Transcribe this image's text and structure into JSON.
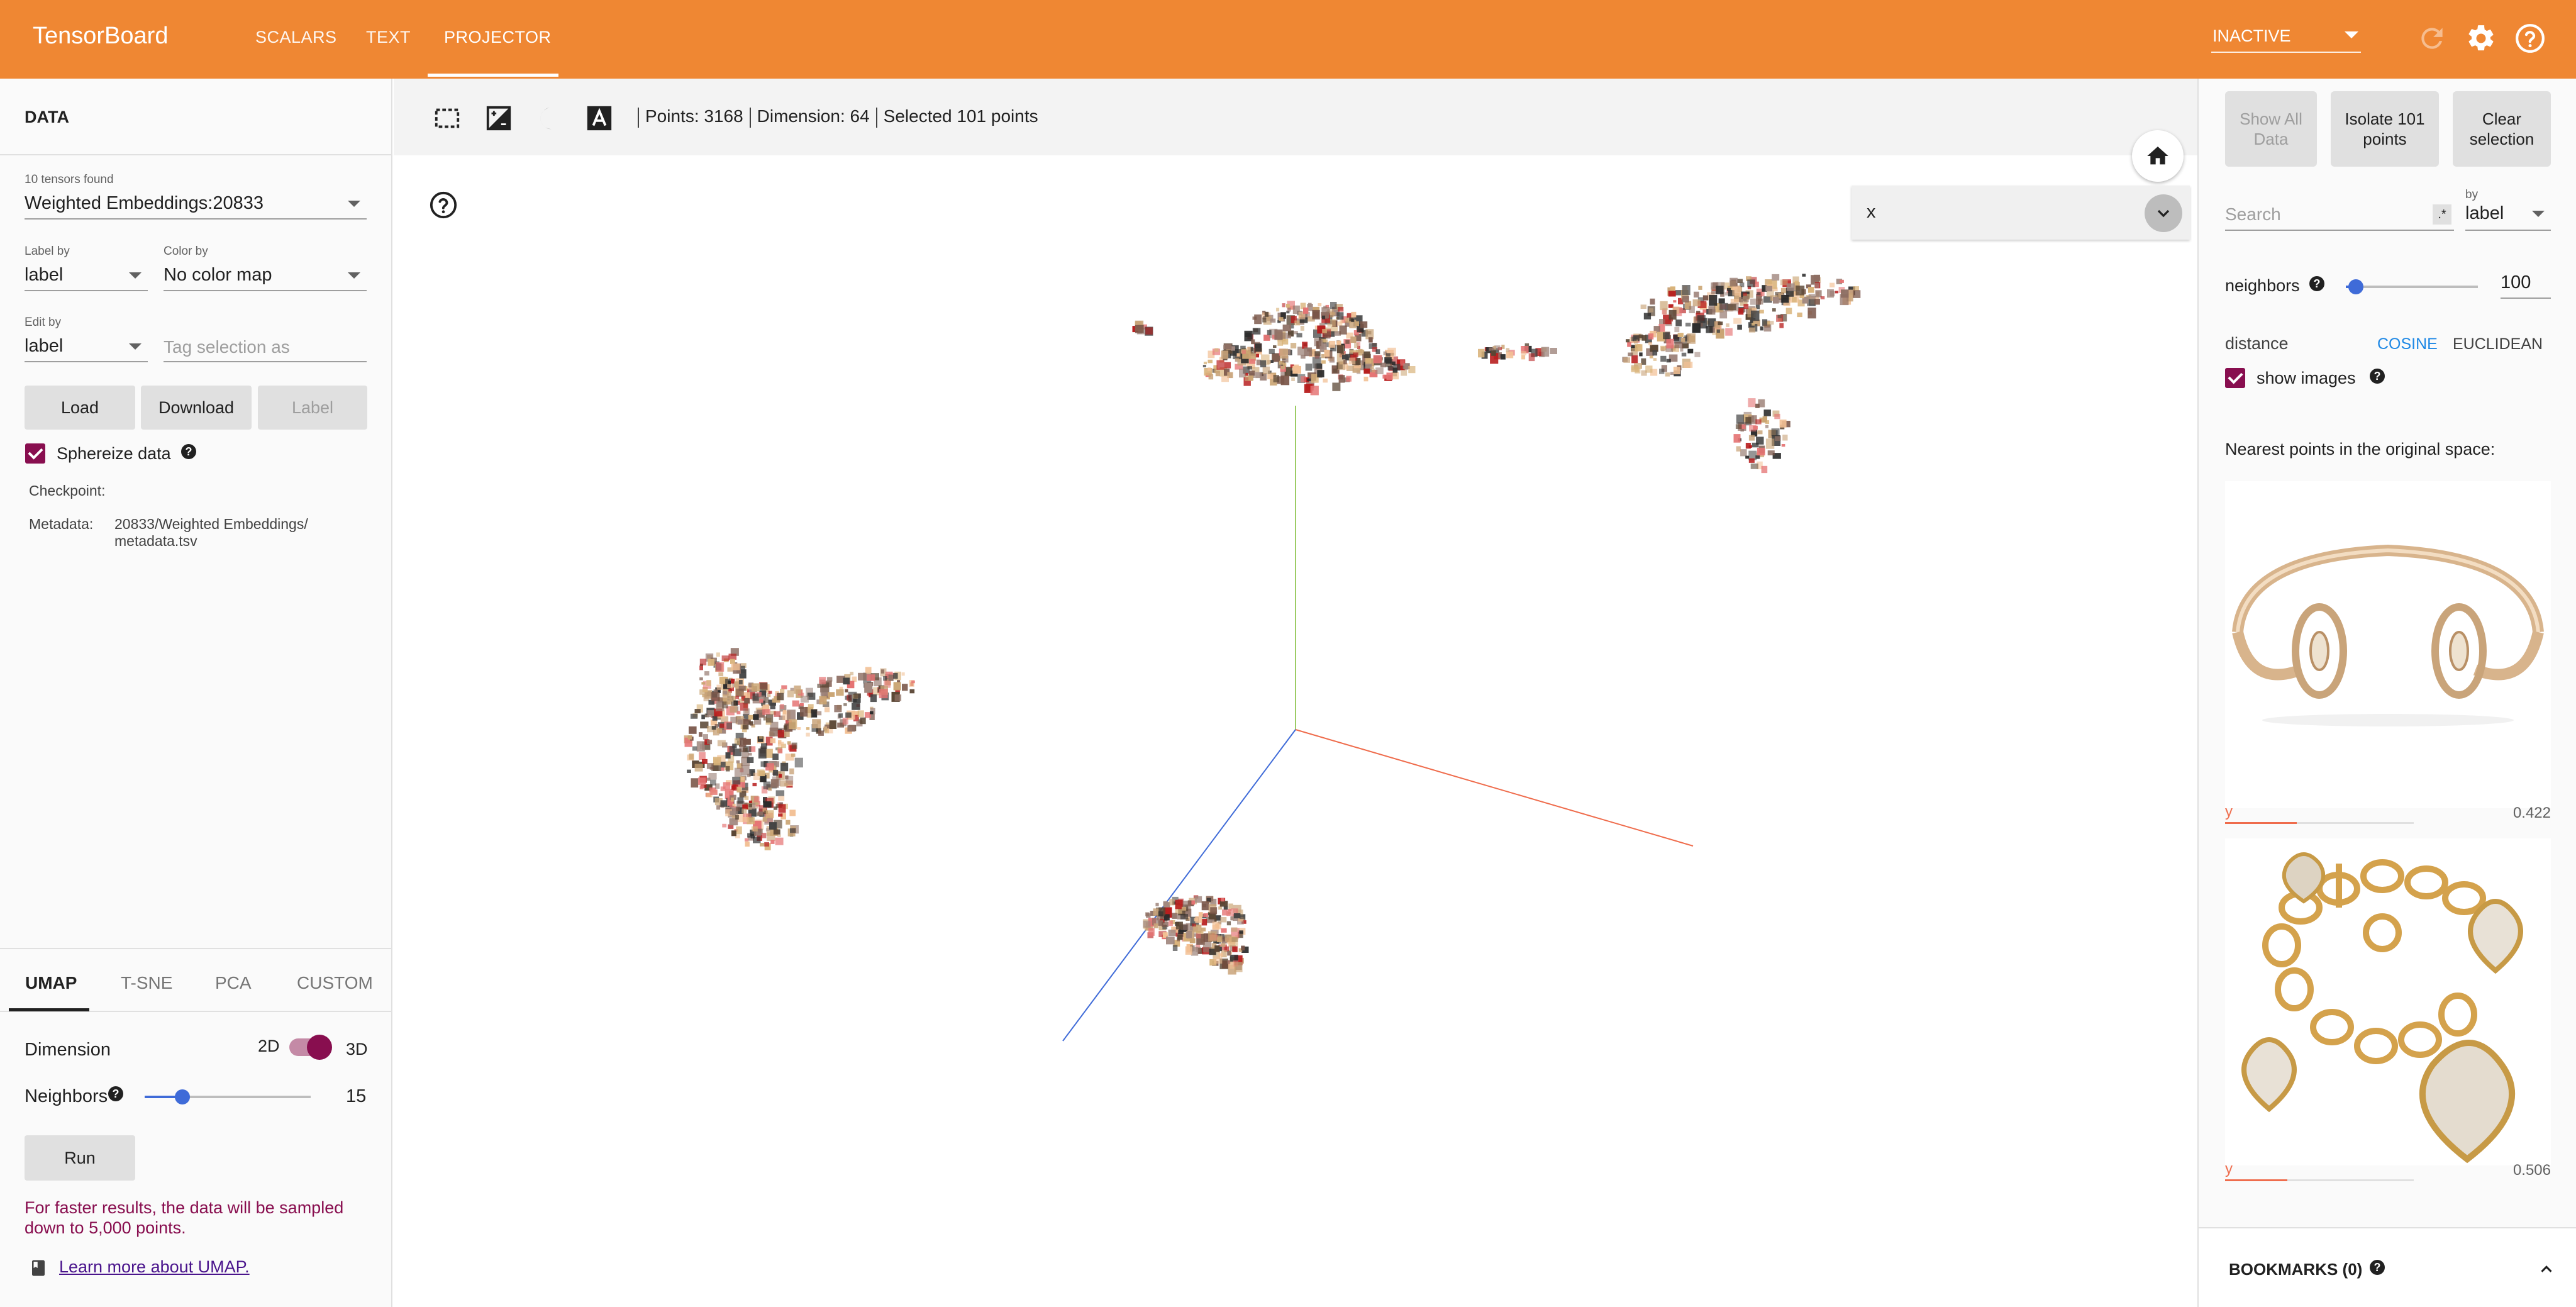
{
  "app": {
    "title": "TensorBoard"
  },
  "nav": {
    "tabs": [
      "SCALARS",
      "TEXT",
      "PROJECTOR"
    ],
    "active": "PROJECTOR"
  },
  "header": {
    "run_status": "INACTIVE"
  },
  "left": {
    "section_title": "DATA",
    "tensors_found": "10 tensors found",
    "tensor": "Weighted Embeddings:20833",
    "label_by_label": "Label by",
    "label_by_value": "label",
    "color_by_label": "Color by",
    "color_by_value": "No color map",
    "edit_by_label": "Edit by",
    "edit_by_value": "label",
    "tag_placeholder": "Tag selection as",
    "buttons": {
      "load": "Load",
      "download": "Download",
      "label": "Label"
    },
    "sphereize": "Sphereize data",
    "checkpoint_label": "Checkpoint:",
    "metadata_label": "Metadata:",
    "metadata_value_1": "20833/Weighted Embeddings/",
    "metadata_value_2": "metadata.tsv",
    "proj_tabs": [
      "UMAP",
      "T-SNE",
      "PCA",
      "CUSTOM"
    ],
    "dimension_label": "Dimension",
    "dim_2d": "2D",
    "dim_3d": "3D",
    "neighbors_label": "Neighbors",
    "neighbors_value": "15",
    "run_button": "Run",
    "sample_note_1": "For faster results, the data will be sampled",
    "sample_note_2": "down to 5,000 points.",
    "learn_more": "Learn more about UMAP."
  },
  "toolbar": {
    "points": "Points: 3168",
    "dimension": "Dimension: 64",
    "selected": "Selected 101 points"
  },
  "search_box": {
    "value": "x"
  },
  "right": {
    "show_all": "Show All Data",
    "isolate": "Isolate 101 points",
    "clear": "Clear selection",
    "search_placeholder": "Search",
    "regex": ".*",
    "by_label": "by",
    "by_value": "label",
    "neighbors_label": "neighbors",
    "neighbors_value": "100",
    "distance_label": "distance",
    "cosine": "COSINE",
    "euclidean": "EUCLIDEAN",
    "show_images": "show images",
    "nearest_title": "Nearest points in the original space:",
    "nearest": [
      {
        "label": "y",
        "value": "0.422",
        "fraction": 0.38
      },
      {
        "label": "y",
        "value": "0.506",
        "fraction": 0.33
      }
    ],
    "bookmarks": "BOOKMARKS (0)"
  },
  "colors": {
    "header": "#ef8733",
    "accent": "#880e4f",
    "slider": "#3f6bd8",
    "link": "#1e88e5"
  }
}
